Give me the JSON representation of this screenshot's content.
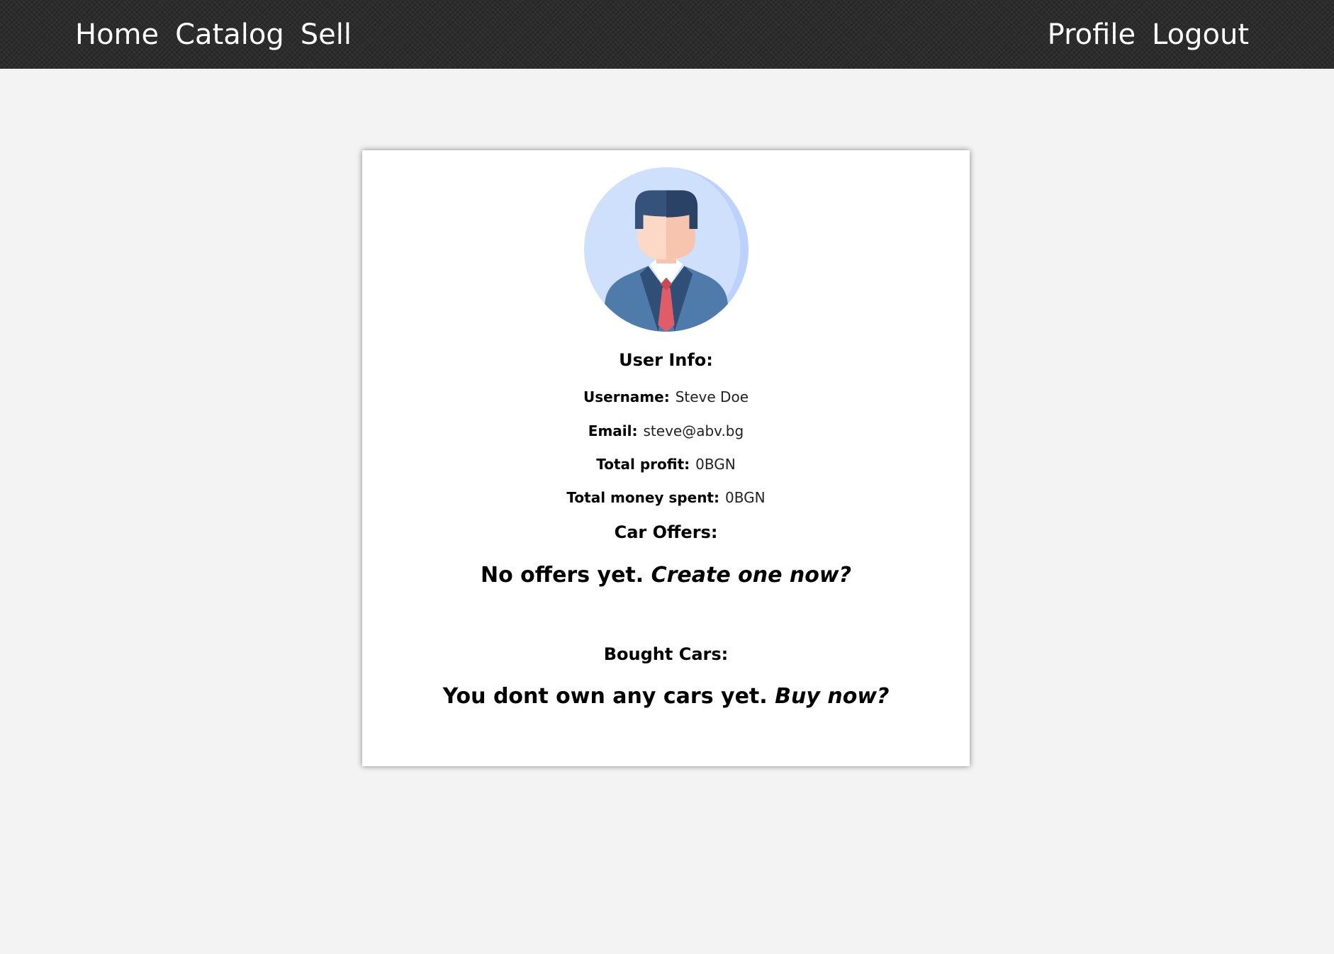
{
  "nav": {
    "left": [
      "Home",
      "Catalog",
      "Sell"
    ],
    "right": [
      "Profile",
      "Logout"
    ]
  },
  "profile": {
    "avatar": "user-avatar-businessman",
    "user_info_title": "User Info:",
    "username_label": "Username:",
    "username": "Steve Doe",
    "email_label": "Email:",
    "email": "steve@abv.bg",
    "profit_label": "Total profit:",
    "profit": "0BGN",
    "spent_label": "Total money spent:",
    "spent": "0BGN",
    "offers_title": "Car Offers:",
    "offers_empty": "No offers yet.",
    "offers_cta": "Create one now?",
    "bought_title": "Bought Cars:",
    "bought_empty": "You dont own any cars yet.",
    "bought_cta": "Buy now?"
  },
  "colors": {
    "navbar": "#2c2c2c",
    "background": "#f3f3f3",
    "card": "#ffffff"
  }
}
